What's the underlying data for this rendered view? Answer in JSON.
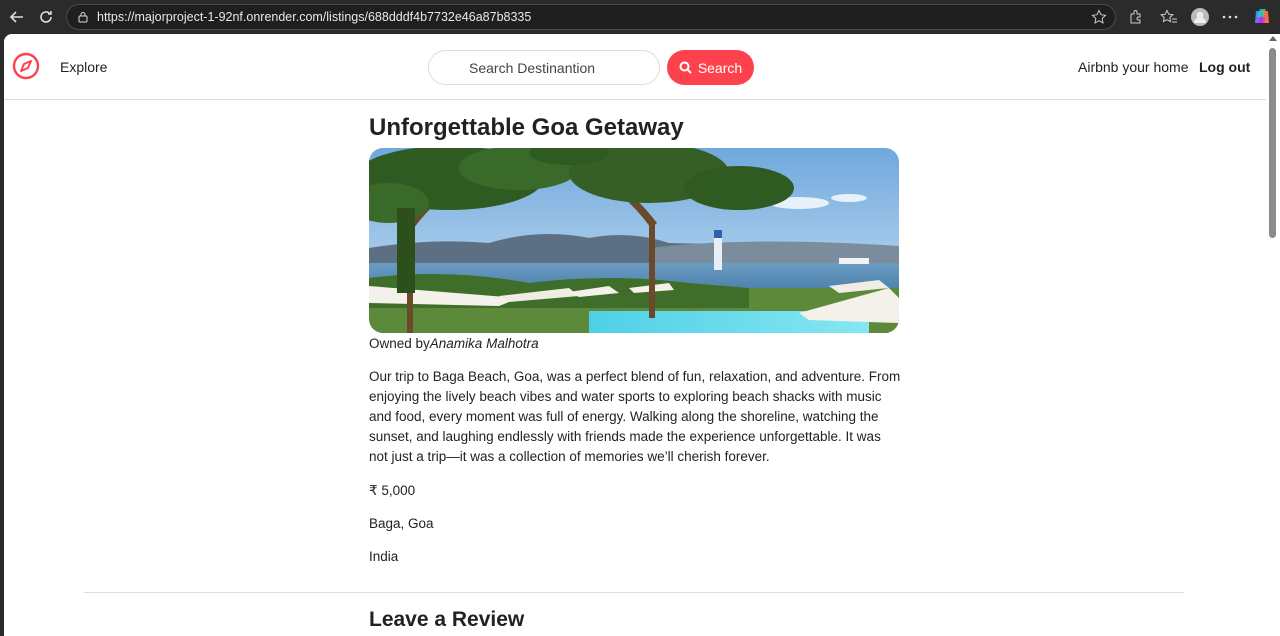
{
  "browser": {
    "url": "https://majorproject-1-92nf.onrender.com/listings/688dddf4b7732e46a87b8335"
  },
  "navbar": {
    "explore_label": "Explore",
    "search_placeholder": "Search Destinantion",
    "search_button_label": "Search",
    "host_link_label": "Airbnb your home",
    "logout_label": "Log out",
    "brand_color": "#fe424d"
  },
  "listing": {
    "title": "Unforgettable Goa Getaway",
    "owner_prefix": "Owned by",
    "owner_name": "Anamika Malhotra",
    "description": "Our trip to Baga Beach, Goa, was a perfect blend of fun, relaxation, and adventure. From enjoying the lively beach vibes and water sports to exploring beach shacks with music and food, every moment was full of energy. Walking along the shoreline, watching the sunset, and laughing endlessly with friends made the experience unforgettable. It was not just a trip—it was a collection of memories we’ll cherish forever.",
    "price": "₹ 5,000",
    "location": "Baga, Goa",
    "country": "India"
  },
  "review": {
    "heading": "Leave a Review"
  }
}
